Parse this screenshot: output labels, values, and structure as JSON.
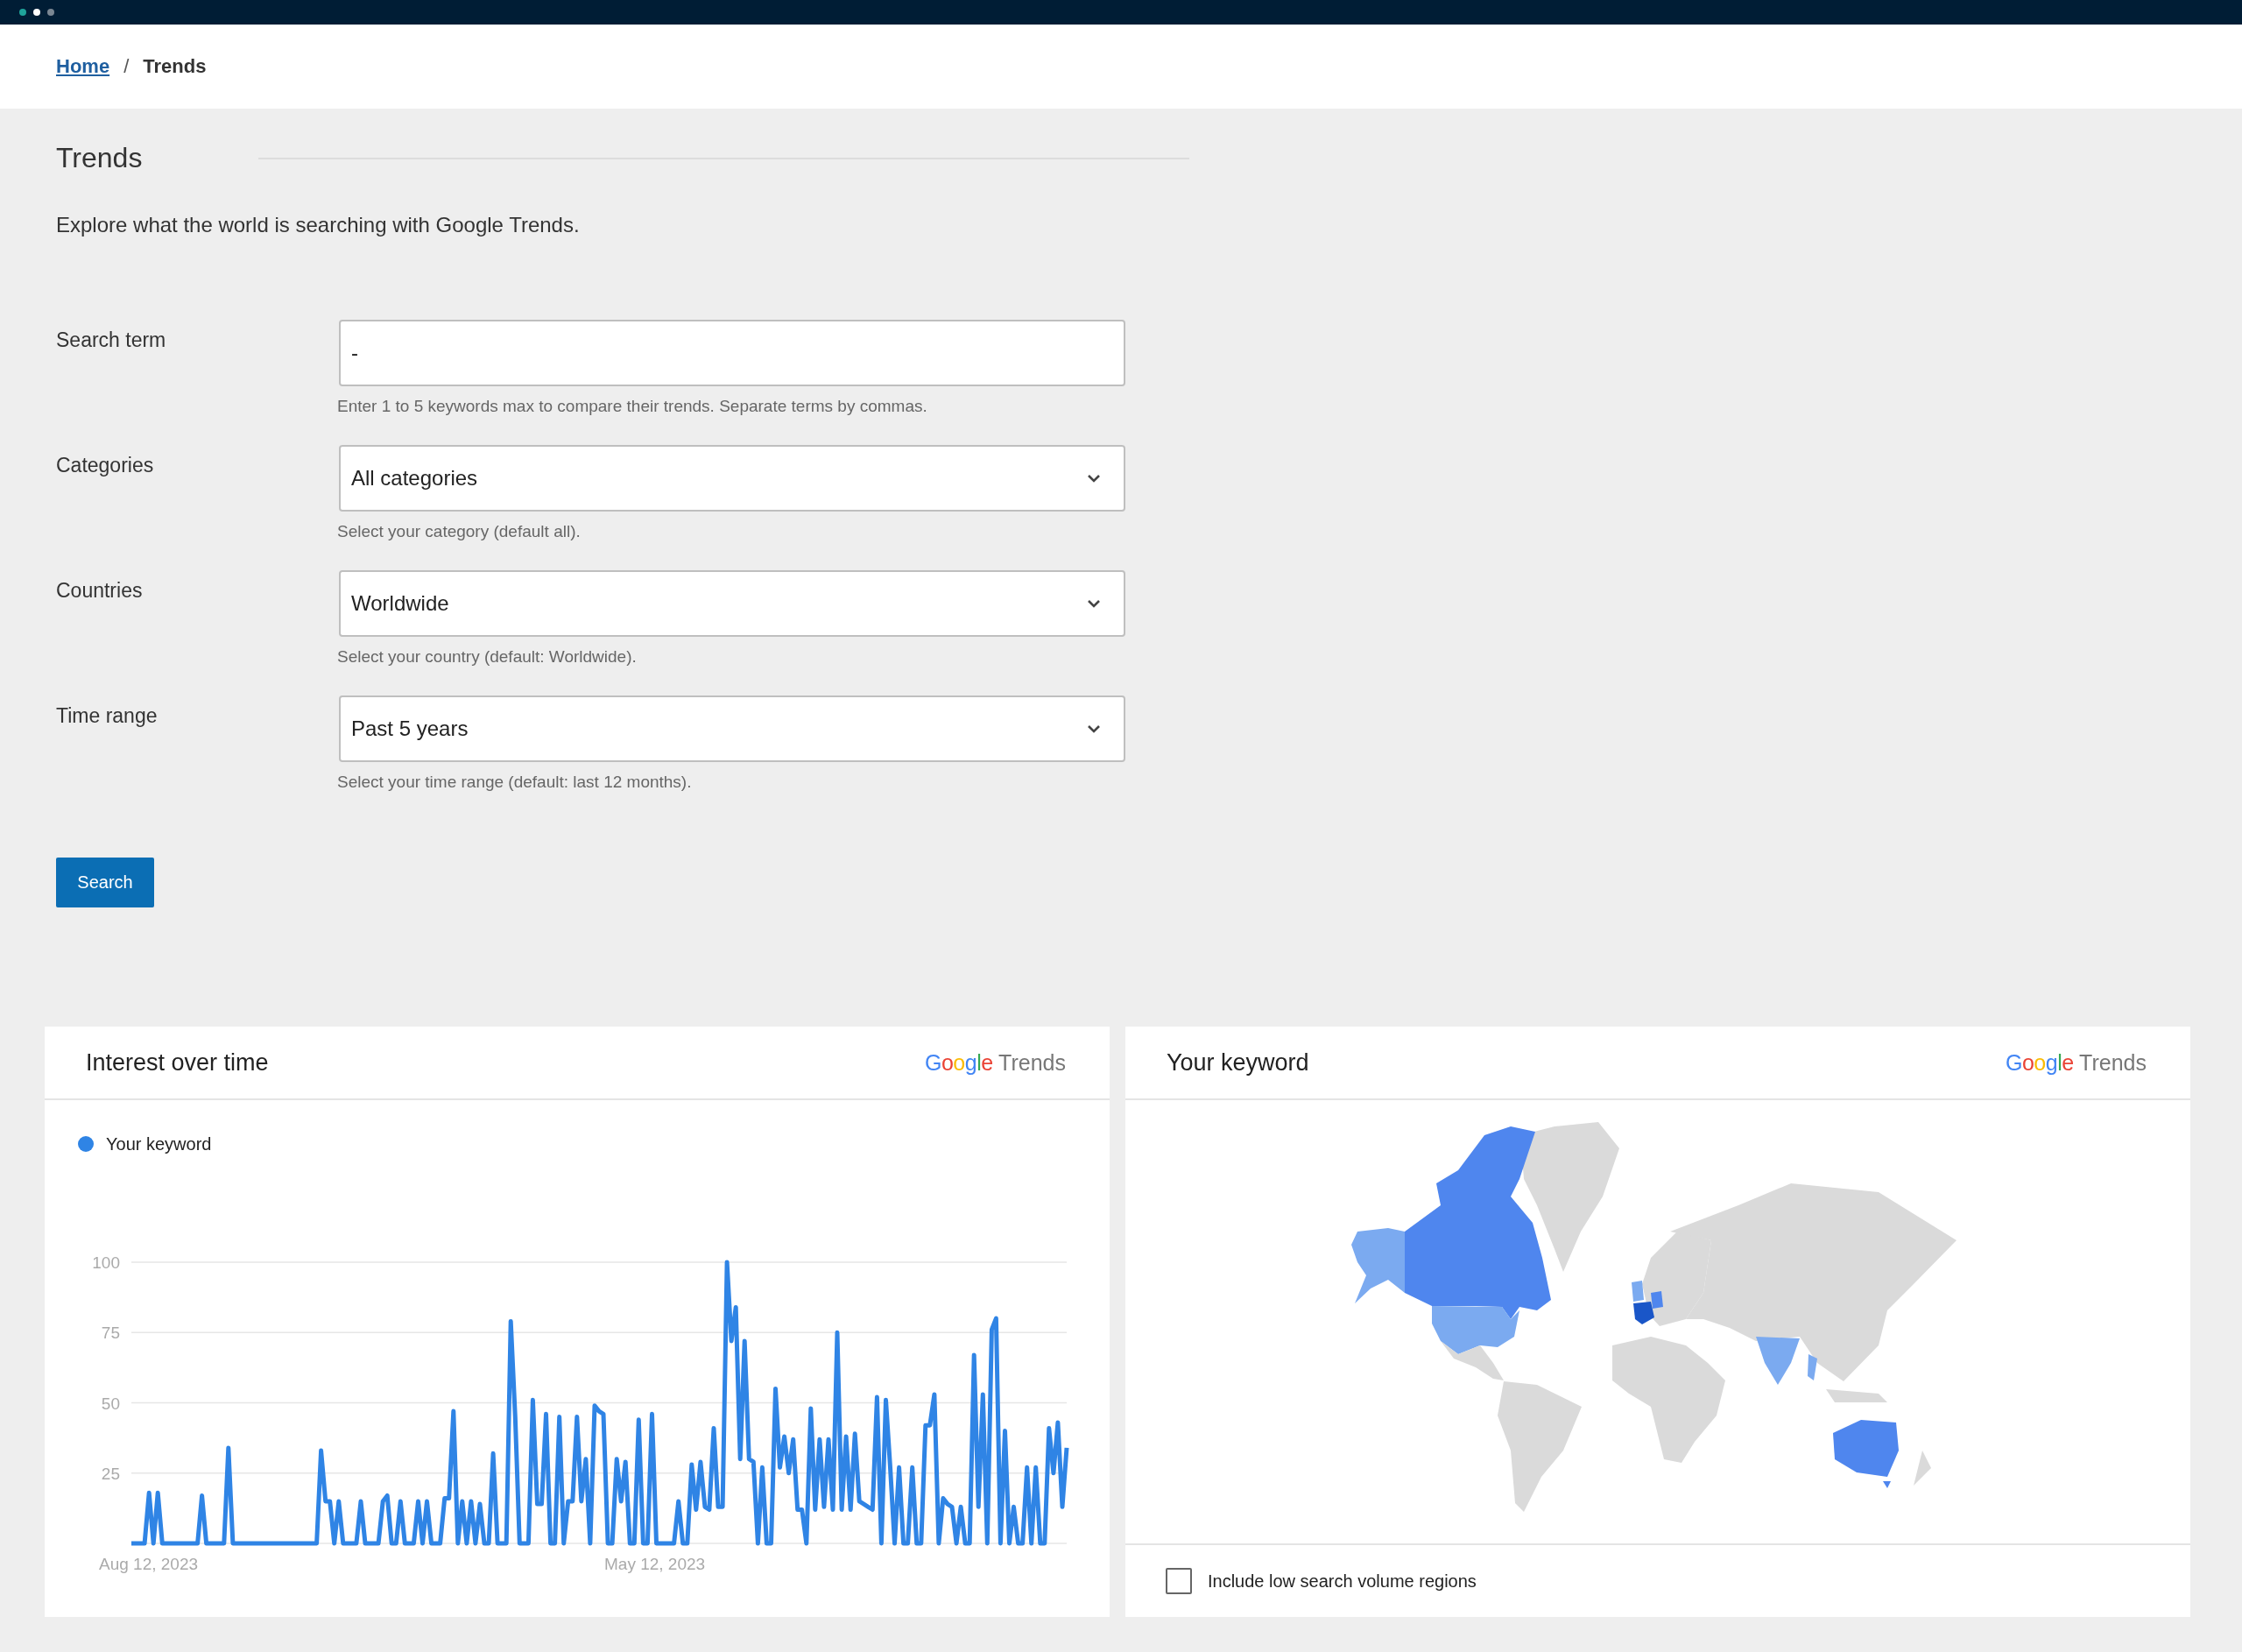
{
  "breadcrumb": [
    {
      "label": "Home",
      "kind": "link"
    },
    {
      "label": "/",
      "kind": "separator"
    },
    {
      "label": "Trends",
      "kind": "current"
    }
  ],
  "page": {
    "title": "Trends",
    "description": "Explore what the world is searching with Google Trends."
  },
  "form": {
    "fields": [
      {
        "kind": "text",
        "label": "Search term",
        "value": "-",
        "hint": "Enter 1 to 5 keywords max to compare their trends. Separate terms by commas."
      },
      {
        "kind": "select",
        "label": "Categories",
        "value": "All categories",
        "hint": "Select your category (default all)."
      },
      {
        "kind": "select",
        "label": "Countries",
        "value": "Worldwide",
        "hint": "Select your country (default: Worldwide)."
      },
      {
        "kind": "select",
        "label": "Time range",
        "value": "Past 5 years",
        "hint": "Select your time range (default: last 12 months)."
      }
    ],
    "submit": "Search"
  },
  "interest_card": {
    "title": "Interest over time",
    "logo": {
      "brand": "Google",
      "product": "Trends"
    },
    "x_axis_labels": [
      "Aug 12, 2023",
      "May 12, 2023"
    ],
    "chart_data": {
      "type": "line",
      "grid": true,
      "ylim": [
        0,
        100
      ],
      "yticks": [
        25,
        50,
        75,
        100
      ],
      "series": [
        {
          "name": "Your keyword",
          "color": "#2f84e5",
          "values": [
            0,
            0,
            0,
            0,
            18,
            0,
            18,
            0,
            0,
            0,
            0,
            0,
            0,
            0,
            0,
            0,
            17,
            0,
            0,
            0,
            0,
            0,
            34,
            0,
            0,
            0,
            0,
            0,
            0,
            0,
            0,
            0,
            0,
            0,
            0,
            0,
            0,
            0,
            0,
            0,
            0,
            0,
            0,
            33,
            15,
            15,
            0,
            15,
            0,
            0,
            0,
            0,
            15,
            0,
            0,
            0,
            0,
            15,
            17,
            0,
            0,
            15,
            0,
            0,
            0,
            15,
            0,
            15,
            0,
            0,
            0,
            16,
            16,
            47,
            0,
            15,
            0,
            15,
            0,
            14,
            0,
            0,
            32,
            0,
            0,
            0,
            79,
            45,
            0,
            0,
            0,
            51,
            14,
            14,
            46,
            0,
            0,
            45,
            0,
            15,
            15,
            45,
            15,
            30,
            0,
            49,
            47,
            46,
            0,
            0,
            30,
            15,
            29,
            0,
            0,
            44,
            0,
            0,
            46,
            0,
            0,
            0,
            0,
            0,
            15,
            0,
            0,
            28,
            12,
            29,
            13,
            12,
            41,
            13,
            13,
            100,
            72,
            84,
            30,
            72,
            30,
            29,
            0,
            27,
            0,
            0,
            55,
            27,
            38,
            25,
            37,
            12,
            12,
            0,
            48,
            12,
            37,
            13,
            37,
            12,
            75,
            12,
            38,
            12,
            39,
            15,
            14,
            13,
            12,
            52,
            0,
            51,
            27,
            0,
            27,
            0,
            0,
            27,
            0,
            0,
            42,
            42,
            53,
            0,
            16,
            14,
            13,
            0,
            13,
            0,
            0,
            67,
            13,
            53,
            0,
            76,
            80,
            0,
            40,
            0,
            13,
            0,
            0,
            27,
            0,
            27,
            0,
            0,
            41,
            25,
            43,
            13,
            34
          ]
        }
      ]
    }
  },
  "map_card": {
    "title": "Your keyword",
    "logo": {
      "brand": "Google",
      "product": "Trends"
    },
    "checkbox": {
      "label": "Include low search volume regions",
      "checked": false
    }
  }
}
